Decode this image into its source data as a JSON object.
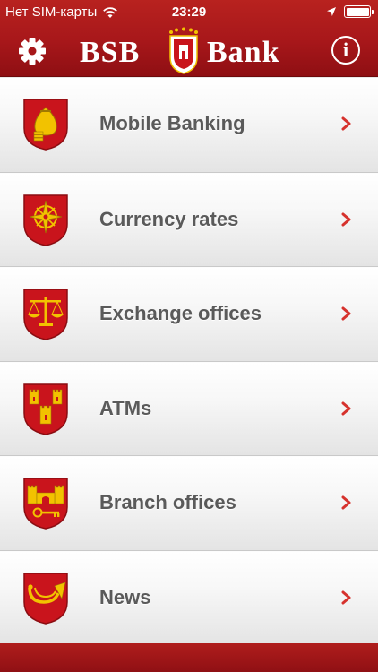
{
  "status_bar": {
    "carrier": "Нет SIM-карты",
    "time": "23:29"
  },
  "header": {
    "logo_left": "BSB",
    "logo_right": "Bank"
  },
  "menu": {
    "items": [
      {
        "label": "Mobile Banking",
        "icon": "money-bag-icon"
      },
      {
        "label": "Currency rates",
        "icon": "compass-rose-icon"
      },
      {
        "label": "Exchange offices",
        "icon": "scales-icon"
      },
      {
        "label": "ATMs",
        "icon": "towers-icon"
      },
      {
        "label": "Branch offices",
        "icon": "castle-key-icon"
      },
      {
        "label": "News",
        "icon": "post-horn-icon"
      }
    ]
  },
  "colors": {
    "header": "#a7171a",
    "crest_red": "#c9141c",
    "crest_gold": "#f2c200",
    "chevron": "#d6322d",
    "label": "#5a5a5a"
  }
}
